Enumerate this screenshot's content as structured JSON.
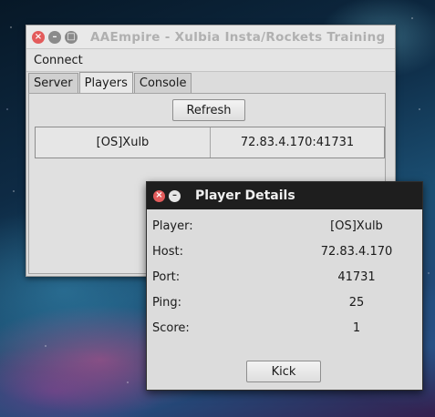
{
  "main_window": {
    "title": "AAEmpire - Xulbia Insta/Rockets Training",
    "menu": [
      "Connect"
    ],
    "tabs": [
      "Server",
      "Players",
      "Console"
    ],
    "active_tab": "Players",
    "refresh_label": "Refresh",
    "players": [
      {
        "name": "[OS]Xulb",
        "host": "72.83.4.170:41731"
      }
    ]
  },
  "dialog": {
    "title": "Player Details",
    "fields": [
      {
        "label": "Player:",
        "value": "[OS]Xulb"
      },
      {
        "label": "Host:",
        "value": "72.83.4.170"
      },
      {
        "label": "Port:",
        "value": "41731"
      },
      {
        "label": "Ping:",
        "value": "25"
      },
      {
        "label": "Score:",
        "value": "1"
      }
    ],
    "kick_label": "Kick"
  },
  "icons": {
    "close": "close-icon",
    "minimize": "minimize-icon",
    "maximize": "maximize-icon"
  },
  "colors": {
    "close_button": "#e35b5b",
    "dialog_titlebar": "#1e1e1e",
    "window_bg": "#dcdcdc"
  }
}
